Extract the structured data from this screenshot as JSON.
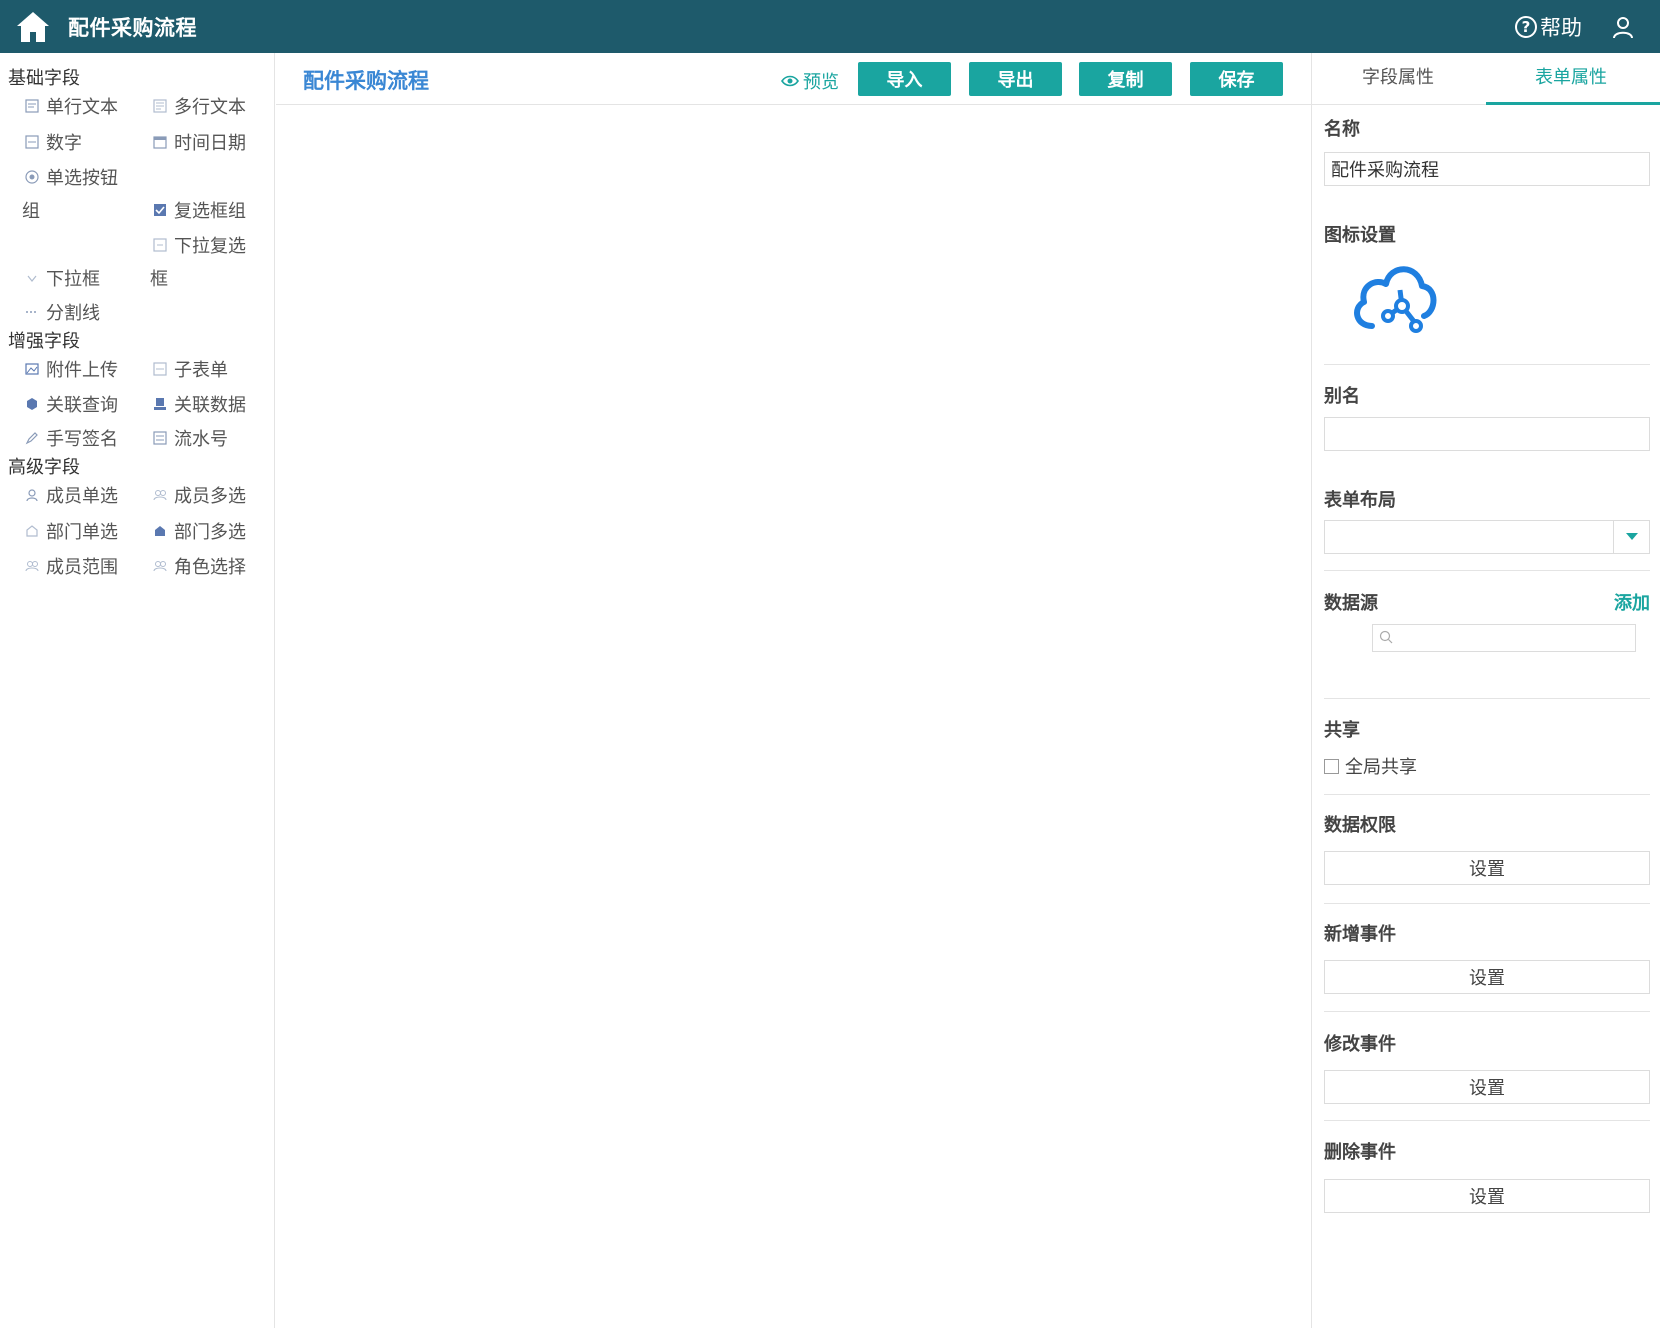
{
  "topbar": {
    "title": "配件采购流程",
    "help_label": "帮助",
    "help_icon_char": "?"
  },
  "palette": {
    "basic": {
      "title": "基础字段",
      "single_text": "单行文本",
      "multi_text": "多行文本",
      "number": "数字",
      "datetime": "时间日期",
      "radio_a": "单选按钮",
      "radio_b": "组",
      "checkbox_group": "复选框组",
      "dropdown_multi_a": "下拉复选",
      "dropdown_multi_b": "框",
      "dropdown": "下拉框",
      "divider": "分割线"
    },
    "enhanced": {
      "title": "增强字段",
      "attachment": "附件上传",
      "subform": "子表单",
      "related_query": "关联查询",
      "related_data": "关联数据",
      "signature": "手写签名",
      "serial": "流水号"
    },
    "advanced": {
      "title": "高级字段",
      "member_single": "成员单选",
      "member_multi": "成员多选",
      "dept_single": "部门单选",
      "dept_multi": "部门多选",
      "member_range": "成员范围",
      "role_select": "角色选择"
    }
  },
  "toolbar": {
    "form_title": "配件采购流程",
    "preview": "预览",
    "import": "导入",
    "export": "导出",
    "copy": "复制",
    "save": "保存"
  },
  "panel": {
    "tab_field": "字段属性",
    "tab_form": "表单属性",
    "name_label": "名称",
    "name_value": "配件采购流程",
    "icon_label": "图标设置",
    "alias_label": "别名",
    "alias_value": "",
    "layout_label": "表单布局",
    "layout_value": "",
    "datasource_label": "数据源",
    "datasource_add": "添加",
    "share_label": "共享",
    "global_share": "全局共享",
    "data_perm_label": "数据权限",
    "add_event_label": "新增事件",
    "edit_event_label": "修改事件",
    "delete_event_label": "删除事件",
    "set_label": "设置"
  },
  "colors": {
    "topbar": "#1e5a6b",
    "accent": "#1aa5a0",
    "title_blue": "#3a87d4",
    "icon_blue": "#1f7fe0"
  }
}
